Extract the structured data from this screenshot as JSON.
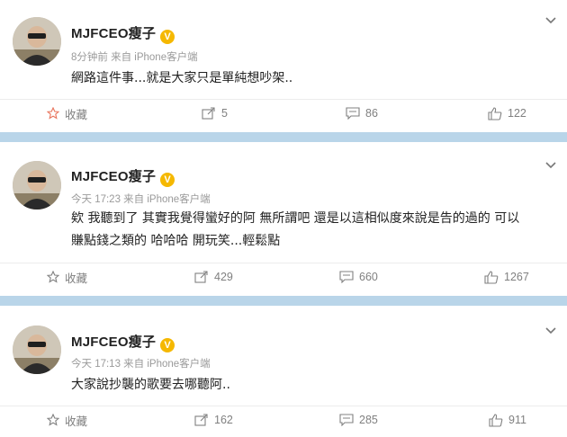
{
  "colors": {
    "accent_verified": "#f5b800",
    "separator": "#b9d5e9",
    "meta_text": "#9a9a9a"
  },
  "posts": [
    {
      "author": "MJFCEO瘦子",
      "verified_icon": "verified-badge-icon",
      "meta": "8分钟前 来自 iPhone客户端",
      "content": "網路這件事...就是大家只是單純想吵架..",
      "actions": {
        "favorite": "收藏",
        "repost": "5",
        "comment": "86",
        "like": "122"
      }
    },
    {
      "author": "MJFCEO瘦子",
      "verified_icon": "verified-badge-icon",
      "meta": "今天 17:23 来自 iPhone客户端",
      "content_lines": [
        "欸 我聽到了 其實我覺得蠻好的阿 無所謂吧 還是以這相似度來說是告的過的 可以",
        "賺點錢之類的 哈哈哈 開玩笑...輕鬆點"
      ],
      "actions": {
        "favorite": "收藏",
        "repost": "429",
        "comment": "660",
        "like": "1267"
      }
    },
    {
      "author": "MJFCEO瘦子",
      "verified_icon": "verified-badge-icon",
      "meta": "今天 17:13 来自 iPhone客户端",
      "content": "大家說抄襲的歌要去哪聽阿..",
      "actions": {
        "favorite": "收藏",
        "repost": "162",
        "comment": "285",
        "like": "911"
      }
    }
  ]
}
